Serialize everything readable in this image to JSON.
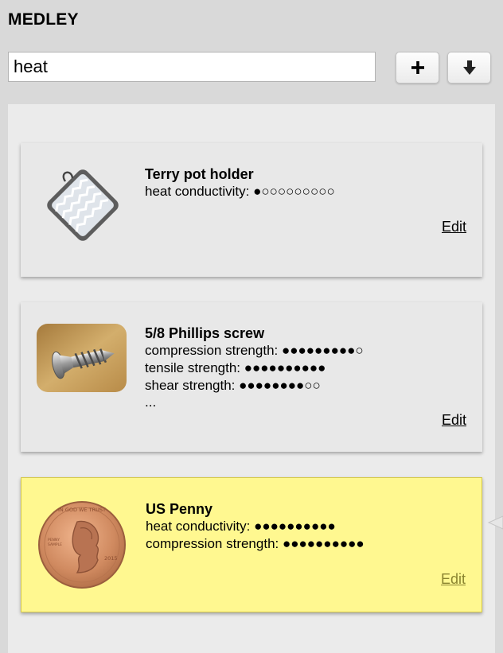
{
  "app": {
    "title": "MEDLEY"
  },
  "search": {
    "value": "heat"
  },
  "toolbar": {
    "add_icon": "plus-icon",
    "download_icon": "download-arrow-icon"
  },
  "cards": [
    {
      "title": "Terry pot holder",
      "image": "pot-holder-image",
      "properties": [
        {
          "label": "heat conductivity: ",
          "rating": "●○○○○○○○○○",
          "filled": 1,
          "max": 10
        }
      ],
      "more": "",
      "edit_label": "Edit",
      "selected": false
    },
    {
      "title": "5/8 Phillips screw",
      "image": "screw-image",
      "properties": [
        {
          "label": "compression strength: ",
          "rating": "●●●●●●●●●○",
          "filled": 9,
          "max": 10
        },
        {
          "label": "tensile strength: ",
          "rating": "●●●●●●●●●●",
          "filled": 10,
          "max": 10
        },
        {
          "label": "shear strength: ",
          "rating": "●●●●●●●●○○",
          "filled": 8,
          "max": 10
        }
      ],
      "more": "...",
      "edit_label": "Edit",
      "selected": false
    },
    {
      "title": "US Penny",
      "image": "penny-image",
      "properties": [
        {
          "label": "heat conductivity: ",
          "rating": "●●●●●●●●●●",
          "filled": 10,
          "max": 10
        },
        {
          "label": "compression strength: ",
          "rating": "●●●●●●●●●●",
          "filled": 10,
          "max": 10
        }
      ],
      "more": "",
      "edit_label": "Edit",
      "selected": true
    }
  ],
  "penny_coin": {
    "top_text": "IN GOD WE TRUST",
    "side_text": "PENNY\nSAMPLE",
    "year": "2015"
  },
  "colors": {
    "selected_card": "#fff890",
    "card": "#e8e8e8",
    "panel": "#ebebeb",
    "background": "#d9d9d9"
  }
}
